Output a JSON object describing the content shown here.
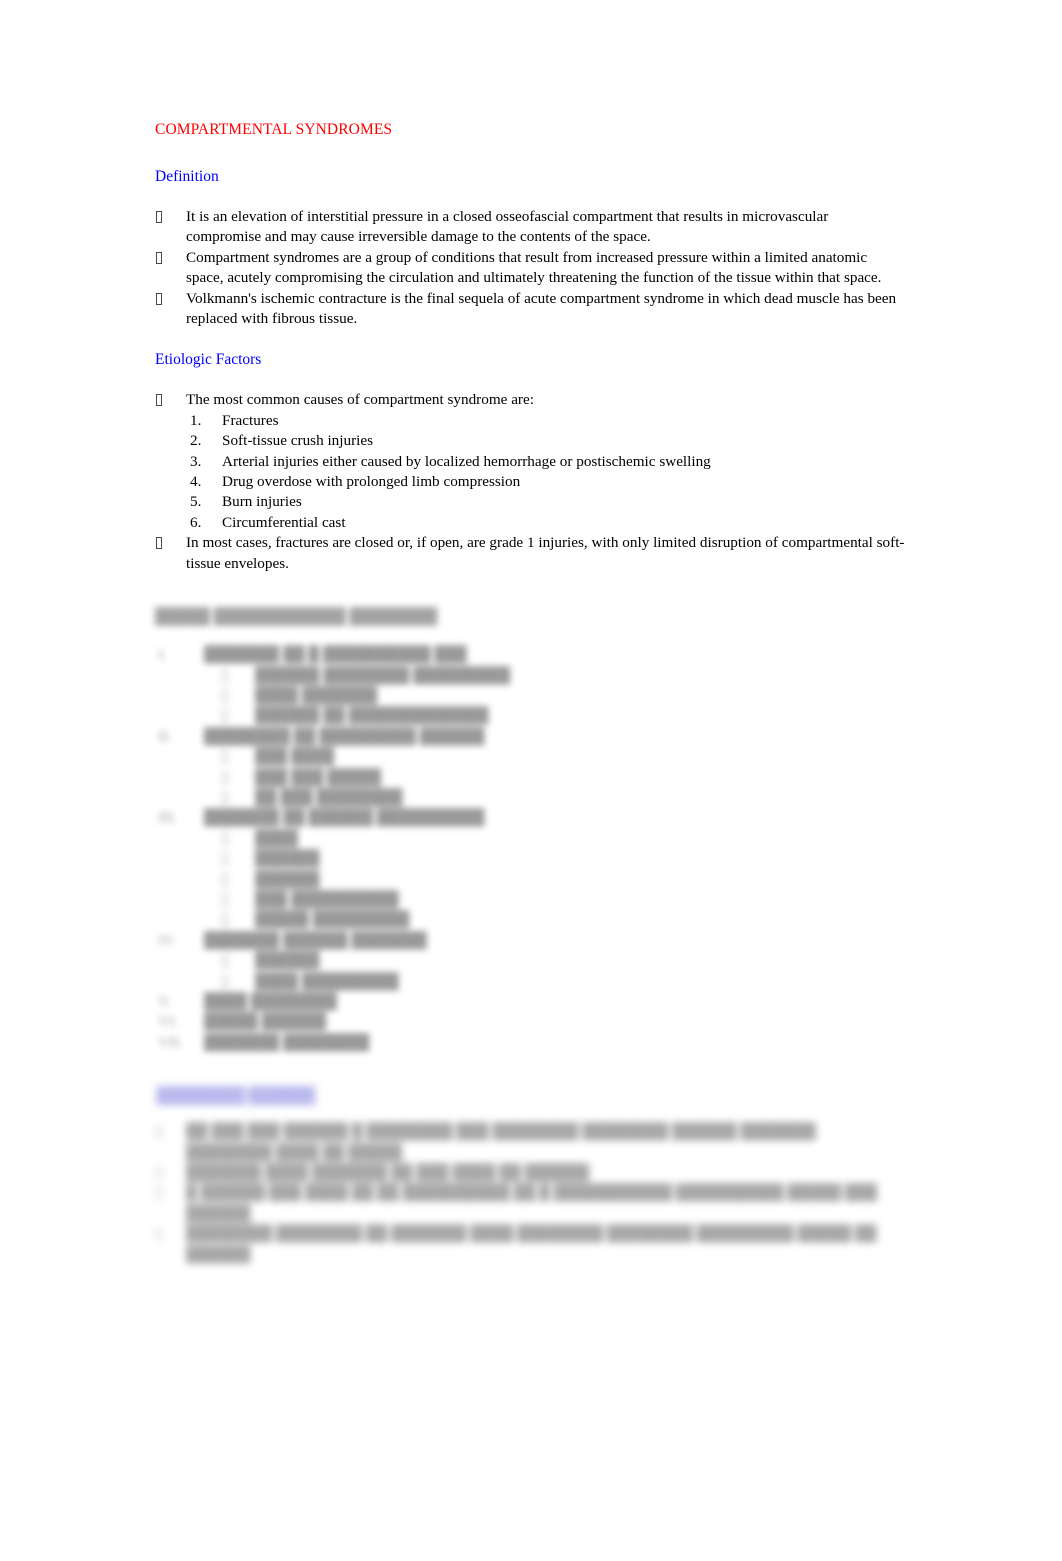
{
  "document": {
    "title": "COMPARTMENTAL SYNDROMES",
    "title_color": "#ff0000",
    "heading_color": "#0000ff",
    "bullet_glyph_name": "wingdings-tofu-box"
  },
  "sections": {
    "definition": {
      "heading": "Definition",
      "bullets": [
        "It is an elevation of interstitial pressure in a closed osseofascial compartment that results in microvascular compromise and may cause irreversible damage to the contents of the space.",
        "Compartment syndromes are a group of conditions that result from increased pressure within a limited anatomic space, acutely compromising the circulation and ultimately threatening the function of the tissue within that space.",
        "Volkmann's ischemic contracture is the final sequela of acute compartment syndrome in which dead muscle has been replaced with fibrous tissue."
      ]
    },
    "etiologic_factors": {
      "heading": "Etiologic Factors",
      "lead_bullet": "The most common causes of compartment syndrome are:",
      "numbered": [
        {
          "number": "1.",
          "text": "Fractures"
        },
        {
          "number": "2.",
          "text": "Soft-tissue crush injuries"
        },
        {
          "number": "3.",
          "text": "Arterial injuries either caused by localized hemorrhage or postischemic swelling"
        },
        {
          "number": "4.",
          "text": "Drug overdose with prolonged limb compression"
        },
        {
          "number": "5.",
          "text": "Burn injuries"
        },
        {
          "number": "6.",
          "text": "Circumferential cast"
        }
      ],
      "closing_bullet": "In most cases, fractures are closed or, if open, are grade 1 injuries, with only limited disruption of compartmental soft-tissue envelopes."
    },
    "redacted_classification": {
      "heading": "█████ ████████████ ████████",
      "items": [
        {
          "number": "I.",
          "text": "███████ ██ █ ██████████ ███",
          "subs": [
            "██████ ████████ █████████",
            "████ ███████",
            "",
            "██████ ██ █████████████"
          ]
        },
        {
          "number": "II.",
          "text": "████████ ██ █████████ ██████",
          "subs": [
            "███ ████",
            "",
            "███ ███ █████",
            "██ ███ ████████"
          ]
        },
        {
          "number": "III.",
          "text": "███████ ██ ██████ ██████████",
          "subs": [
            "████",
            "██████",
            "██████",
            "███ ██████████",
            "",
            "█████ █████████"
          ]
        },
        {
          "number": "IV.",
          "text": "███████ ██████ ███████",
          "subs": [
            "██████",
            "████ █████████"
          ]
        },
        {
          "number": "V.",
          "text": "████ ████████",
          "subs": []
        },
        {
          "number": "VI.",
          "text": "█████ ██████",
          "subs": []
        },
        {
          "number": "VII.",
          "text": "███████ ████████",
          "subs": []
        }
      ]
    },
    "redacted_final": {
      "heading": "████████ ██████",
      "bullets": [
        "██ ███ ███ ██████ █ ████████ ███ ████████ ████████ ██████ ███████ ████████ ████ ██ █████.",
        "███████ ████ ███████ ██ ███ ████ ██ ██████",
        "█ ██████ ███ ████ ██ ██ ██████████ ██ █ ███████████ ██████████ █████ ███ ██████",
        "████████ ████████ ██ ███████ ████ ████████ ████████ █████████ █████ ██ ██████"
      ]
    }
  }
}
